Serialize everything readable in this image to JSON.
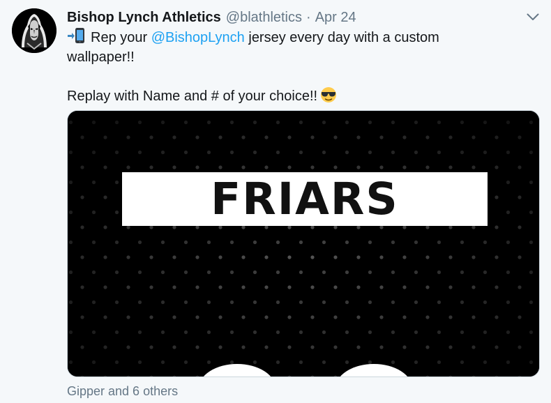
{
  "tweet": {
    "author": {
      "display_name": "Bishop Lynch Athletics",
      "handle": "@blathletics"
    },
    "separator": "·",
    "date": "Apr 24",
    "body": {
      "line1_prefix": "Rep your ",
      "mention": "@BishopLynch",
      "line1_suffix": " jersey every day with a custom",
      "line2": "wallpaper!!",
      "line3": "Replay with Name and # of your choice!!"
    },
    "icons": {
      "caret": "chevron-down-icon",
      "phone_emoji": "mobile-phone-arrow-icon",
      "sunglasses_emoji": "smiling-face-with-sunglasses-icon"
    },
    "media": {
      "banner_text": "FRIARS"
    },
    "liked_by": "Gipper and 6 others"
  },
  "colors": {
    "link": "#1da1f2",
    "secondary_text": "#657786",
    "primary_text": "#14171a",
    "background": "#f5f8fa"
  }
}
